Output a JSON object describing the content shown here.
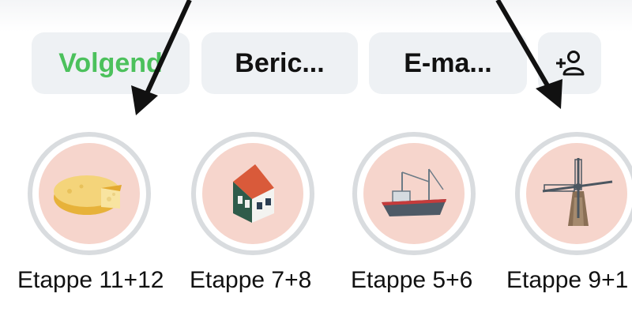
{
  "colors": {
    "accent": "#4cc15c",
    "ring": "#d9dcdf",
    "bubble": "#f6d5cc"
  },
  "actions": {
    "follow_label": "Volgend",
    "message_label": "Beric...",
    "email_label": "E-ma...",
    "add_person_icon": "add-person-icon"
  },
  "highlights": [
    {
      "label": "Etappe 11+12",
      "icon": "cheese-icon"
    },
    {
      "label": "Etappe 7+8",
      "icon": "house-icon"
    },
    {
      "label": "Etappe 5+6",
      "icon": "boat-icon"
    },
    {
      "label": "Etappe 9+1",
      "icon": "windmill-icon"
    }
  ]
}
